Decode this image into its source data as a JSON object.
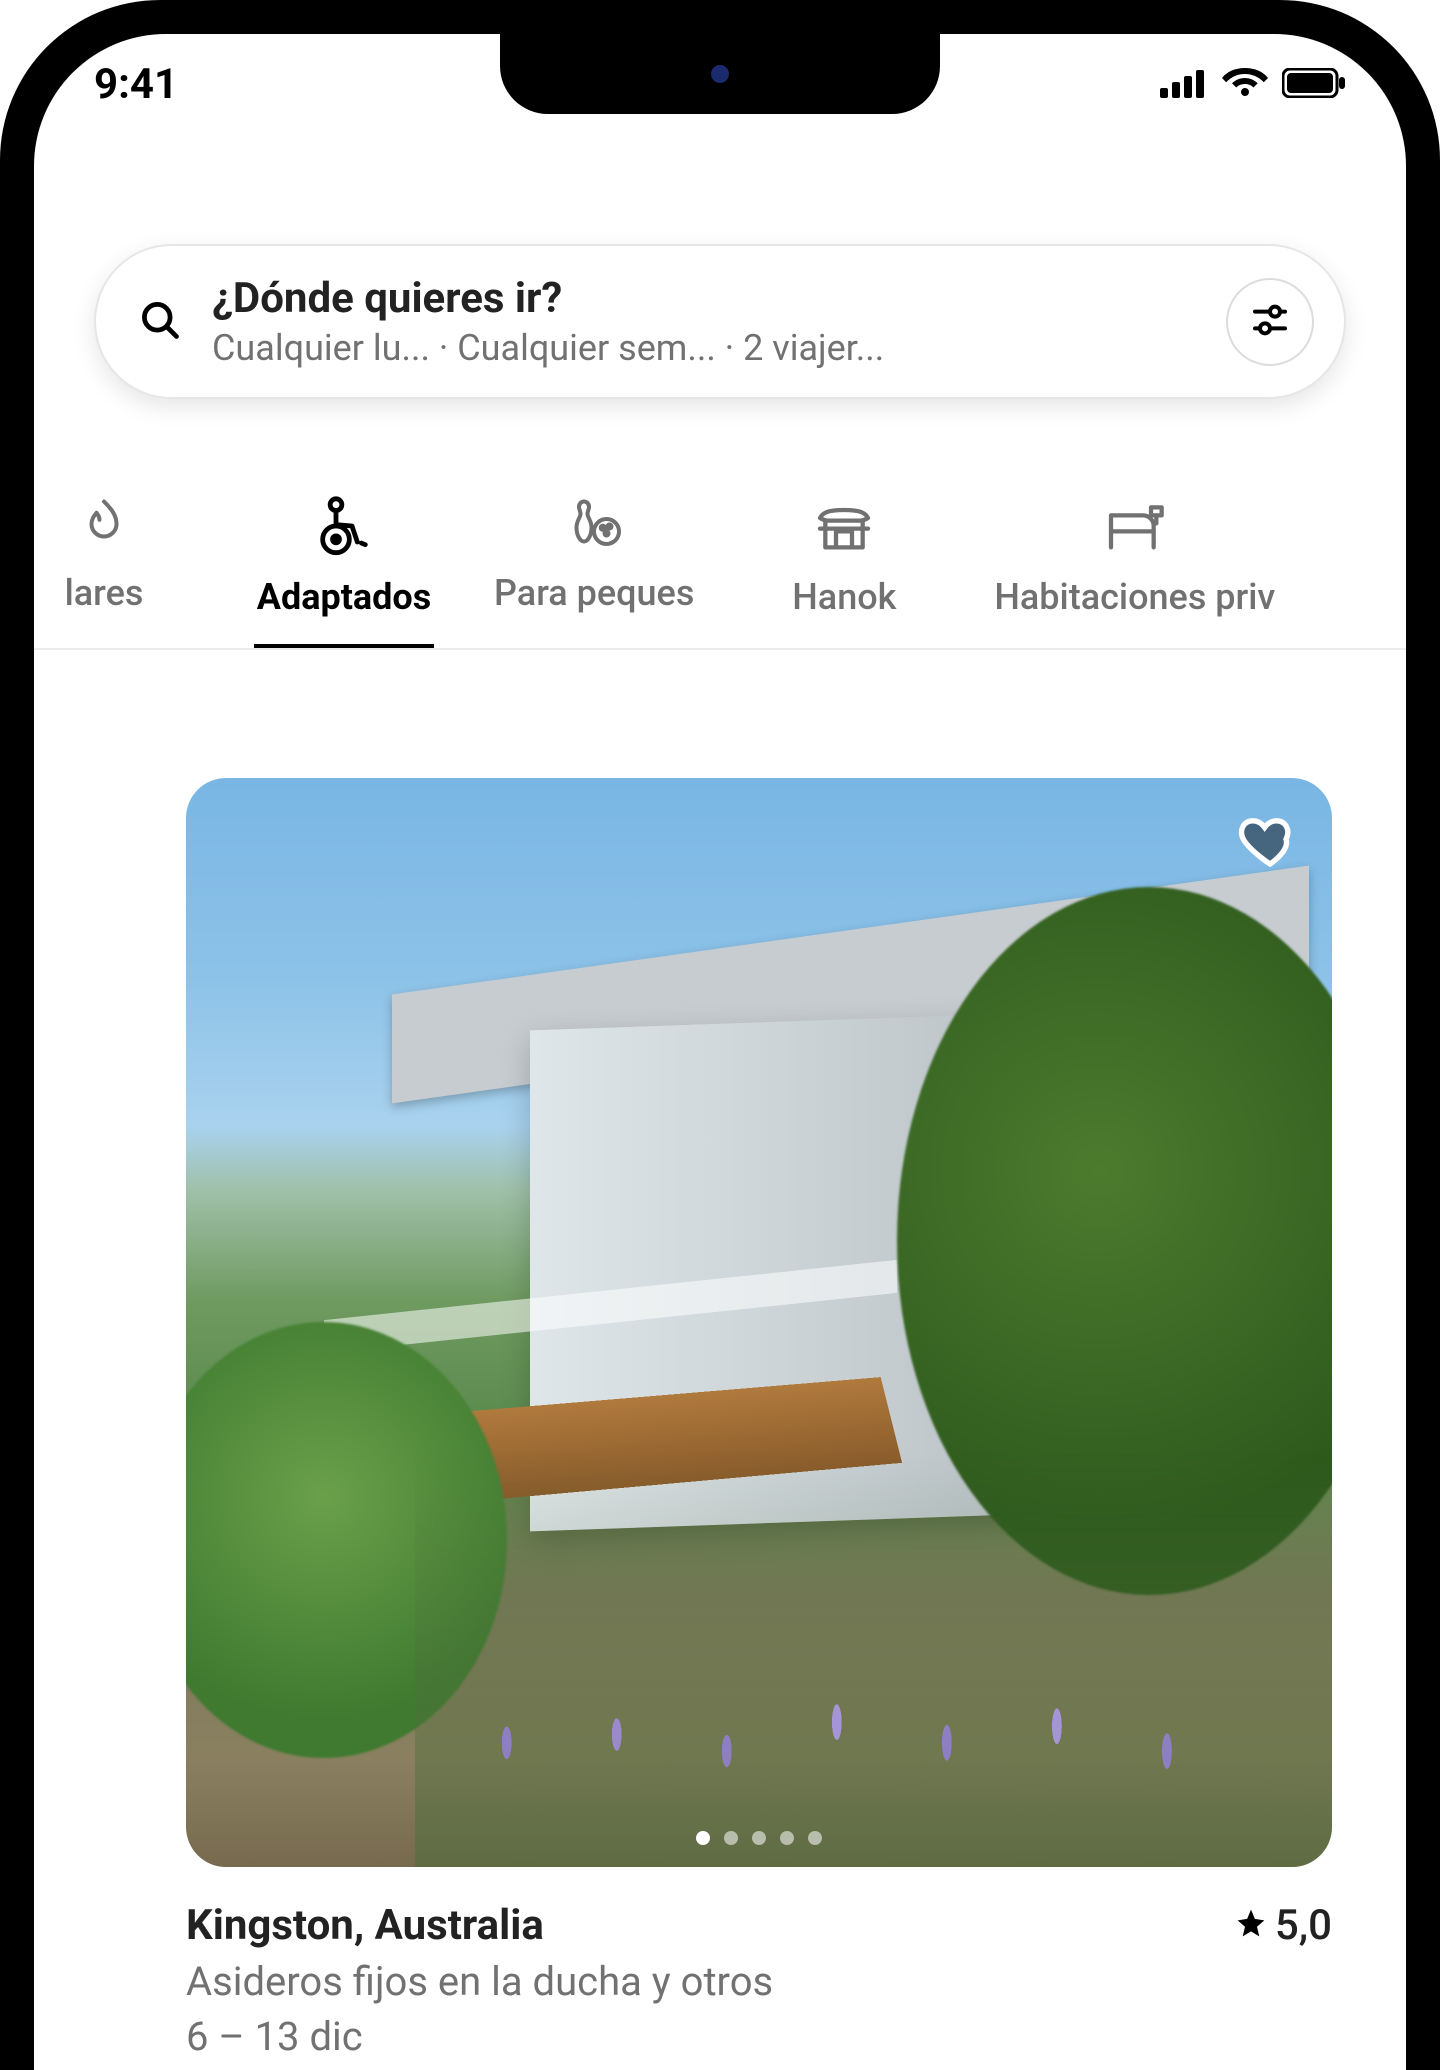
{
  "status": {
    "time": "9:41"
  },
  "search": {
    "title": "¿Dónde quieres ir?",
    "subtitle": "Cualquier lu... · Cualquier sem... · 2 viajer..."
  },
  "tabs": [
    {
      "id": "lares",
      "label": "lares",
      "icon": "flame-icon",
      "active": false
    },
    {
      "id": "adaptados",
      "label": "Adaptados",
      "icon": "wheelchair-icon",
      "active": true
    },
    {
      "id": "peques",
      "label": "Para peques",
      "icon": "bowling-icon",
      "active": false
    },
    {
      "id": "hanok",
      "label": "Hanok",
      "icon": "hanok-icon",
      "active": false
    },
    {
      "id": "privadas",
      "label": "Habitaciones priv",
      "icon": "bed-icon",
      "active": false
    }
  ],
  "listing": {
    "location": "Kingston, Australia",
    "rating": "5,0",
    "description": "Asideros fijos en la ducha y otros",
    "dates": "6 – 13 dic",
    "carousel": {
      "count": 5,
      "active": 0
    }
  }
}
